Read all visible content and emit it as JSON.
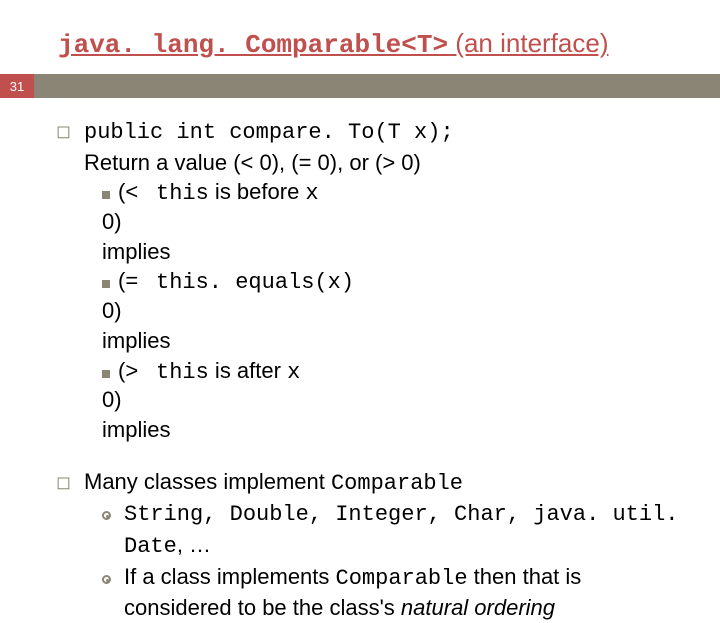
{
  "slide_number": "31",
  "title": {
    "code": "java. lang. Comparable<T>",
    "rest": " (an interface)"
  },
  "point1": {
    "code_line": "public int compare. To(T x);",
    "desc_prefix": "Return a value (< 0), (= 0), or (> 0)",
    "sub": [
      {
        "prefix": "(< 0) implies ",
        "code1": "this",
        "mid": " is before ",
        "code2": "x",
        "tail": ""
      },
      {
        "prefix": "(= 0) implies ",
        "code1": "this. equals(x)",
        "mid": "",
        "code2": "",
        "tail": ""
      },
      {
        "prefix": "(> 0) implies ",
        "code1": "this",
        "mid": " is after ",
        "code2": "x",
        "tail": ""
      }
    ]
  },
  "point2": {
    "line_prefix": "Many classes implement ",
    "line_code": "Comparable",
    "sub1_code": "String, Double, Integer, Char, java. util. Date",
    "sub1_tail": ", …",
    "sub2_a": "If a class implements ",
    "sub2_code": "Comparable",
    "sub2_b": " then that is considered to be the class's ",
    "sub2_italic": "natural ordering"
  }
}
